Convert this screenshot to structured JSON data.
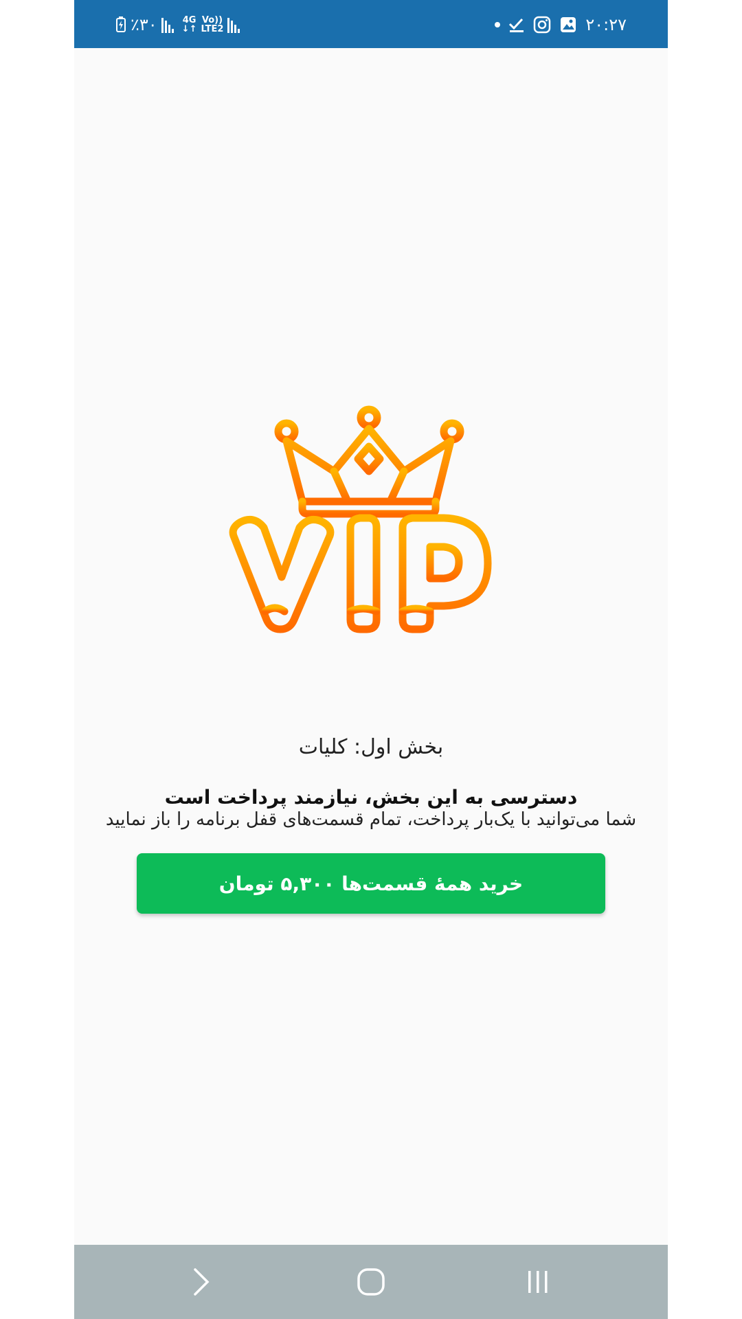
{
  "status_bar": {
    "time": "۲۰:۲۷",
    "battery": "٪۳۰",
    "network_4g": "4G",
    "network_volte": "Vo))",
    "network_lte": "LTE2"
  },
  "icons": {
    "logo": "vip-crown-logo",
    "nav_back": "chevron-right-icon",
    "nav_home": "home-circle-icon",
    "nav_recents": "recents-icon"
  },
  "colors": {
    "status_bar": "#1a6fad",
    "button": "#0dbb58",
    "logo_top": "#ffb400",
    "logo_bottom": "#ff6a00",
    "nav_bar": "#a8b5b8"
  },
  "main": {
    "section_title": "بخش اول: کلیات",
    "access_message": "دسترسی به این بخش، نیازمند پرداخت است",
    "description": "شما می‌توانید با یک‌بار پرداخت، تمام قسمت‌های قفل برنامه را باز نمایید",
    "buy_button_label": "خرید همهٔ قسمت‌ها ۵,۳۰۰ تومان"
  }
}
